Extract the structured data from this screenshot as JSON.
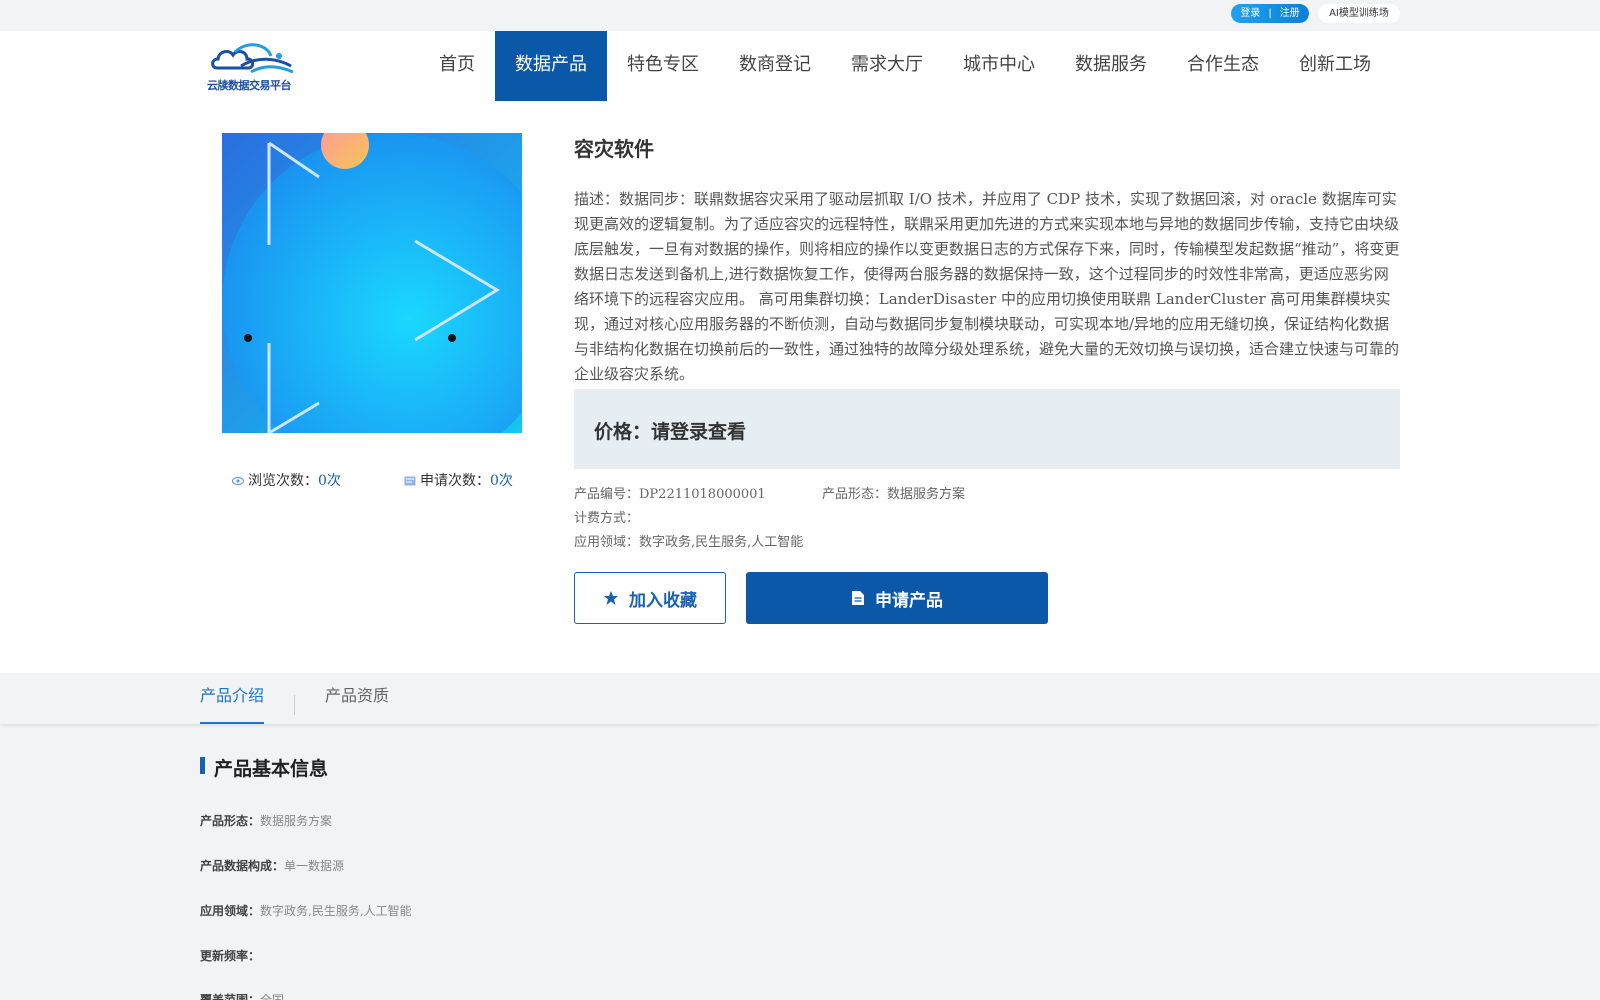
{
  "topbar": {
    "login_label": "登录",
    "separator": "|",
    "register_label": "注册",
    "ai_link": "AI模型训练场"
  },
  "header": {
    "logo_text": "云牍数据交易平台",
    "nav": [
      {
        "label": "首页",
        "active": false
      },
      {
        "label": "数据产品",
        "active": true
      },
      {
        "label": "特色专区",
        "active": false
      },
      {
        "label": "数商登记",
        "active": false
      },
      {
        "label": "需求大厅",
        "active": false
      },
      {
        "label": "城市中心",
        "active": false
      },
      {
        "label": "数据服务",
        "active": false
      },
      {
        "label": "合作生态",
        "active": false
      },
      {
        "label": "创新工场",
        "active": false
      }
    ]
  },
  "product": {
    "title": "容灾软件",
    "description": "描述：数据同步：联鼎数据容灾采用了驱动层抓取 I/O 技术，并应用了 CDP 技术，实现了数据回滚，对 oracle 数据库可实现更高效的逻辑复制。为了适应容灾的远程特性，联鼎采用更加先进的方式来实现本地与异地的数据同步传输，支持它由块级底层触发，一旦有对数据的操作，则将相应的操作以变更数据日志的方式保存下来，同时，传输模型发起数据“推动”，将变更数据日志发送到备机上,进行数据恢复工作，使得两台服务器的数据保持一致，这个过程同步的时效性非常高，更适应恶劣网络环境下的远程容灾应用。 高可用集群切换：LanderDisaster 中的应用切换使用联鼎 LanderCluster 高可用集群模块实现，通过对核心应用服务器的不断侦测，自动与数据同步复制模块联动，可实现本地/异地的应用无缝切换，保证结构化数据与非结构化数据在切换前后的一致性，通过独特的故障分级处理系统，避免大量的无效切换与误切换，适合建立快速与可靠的企业级容灾系统。",
    "price_label": "价格：请登录查看",
    "views_label": "浏览次数：",
    "views_value": "0次",
    "applies_label": "申请次数：",
    "applies_value": "0次",
    "code_line": "产品编号：DP2211018000001",
    "form_line": "产品形态：数据服务方案",
    "billing_line": "计费方式：",
    "domain_line": "应用领域：数字政务,民生服务,人工智能",
    "fav_button": "加入收藏",
    "apply_button": "申请产品"
  },
  "tabs": [
    {
      "label": "产品介绍",
      "active": true
    },
    {
      "label": "产品资质",
      "active": false
    }
  ],
  "basic_info": {
    "title": "产品基本信息",
    "rows": [
      {
        "key": "产品形态：",
        "value": "数据服务方案"
      },
      {
        "key": "产品数据构成：",
        "value": "单一数据源"
      },
      {
        "key": "应用领域：",
        "value": "数字政务,民生服务,人工智能"
      },
      {
        "key": "更新频率：",
        "value": ""
      },
      {
        "key": "覆盖范围：",
        "value": "全国"
      }
    ]
  },
  "colors": {
    "primary": "#0b57a8",
    "accent_link": "#1860b0",
    "tab_active": "#1a73c8",
    "price_bg": "#e6eef3"
  },
  "icons": {
    "views": "eye-icon",
    "applies": "form-icon",
    "favorite": "star-icon",
    "apply": "document-icon"
  }
}
